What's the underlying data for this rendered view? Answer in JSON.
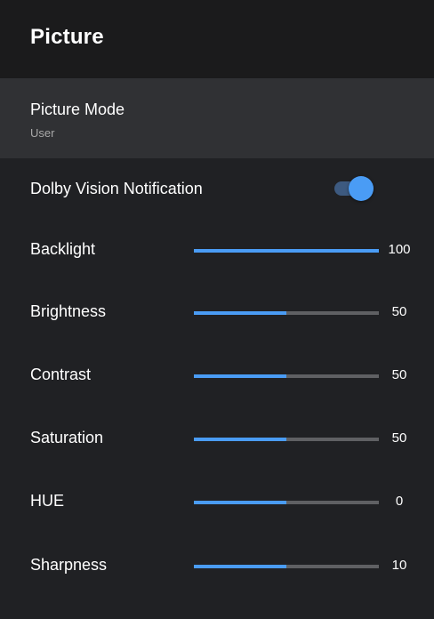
{
  "header": {
    "title": "Picture"
  },
  "picture_mode": {
    "label": "Picture Mode",
    "value": "User"
  },
  "dolby_vision": {
    "label": "Dolby Vision Notification",
    "enabled": true
  },
  "accent_color": "#4a9cf5",
  "sliders": [
    {
      "label": "Backlight",
      "value": "100",
      "fraction": 1.0
    },
    {
      "label": "Brightness",
      "value": "50",
      "fraction": 0.5
    },
    {
      "label": "Contrast",
      "value": "50",
      "fraction": 0.5
    },
    {
      "label": "Saturation",
      "value": "50",
      "fraction": 0.5
    },
    {
      "label": "HUE",
      "value": "0",
      "fraction": 0.5
    },
    {
      "label": "Sharpness",
      "value": "10",
      "fraction": 0.5
    }
  ]
}
